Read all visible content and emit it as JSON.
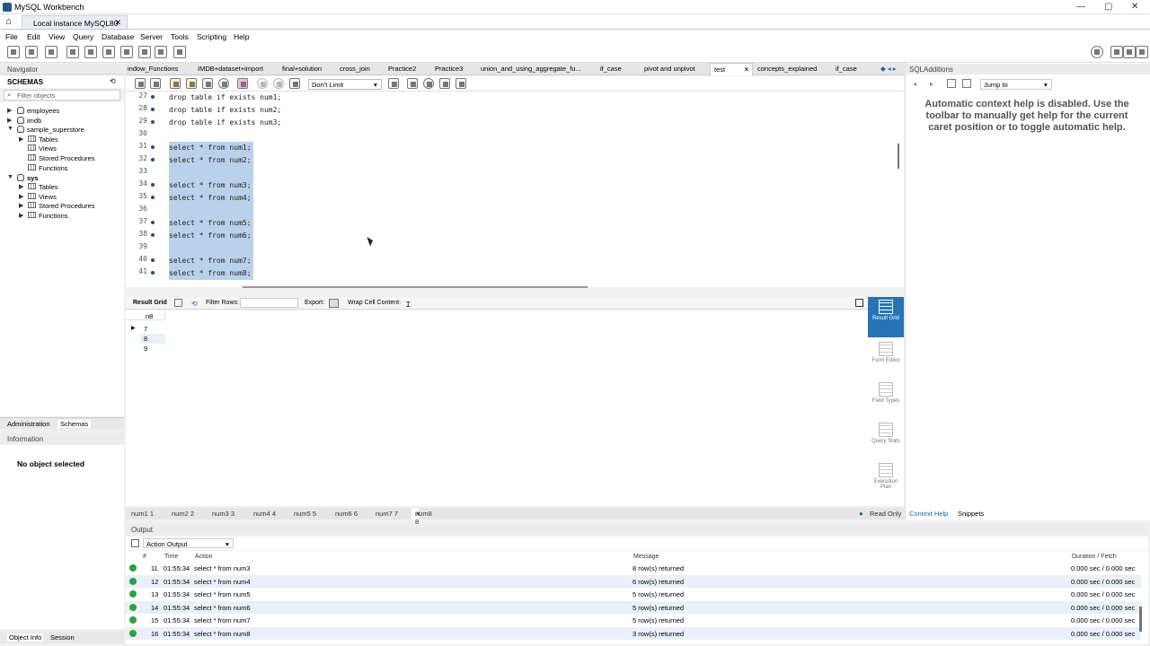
{
  "window": {
    "title": "MySQL Workbench",
    "connection_tab": "Local instance MySQL80"
  },
  "menu": [
    "File",
    "Edit",
    "View",
    "Query",
    "Database",
    "Server",
    "Tools",
    "Scripting",
    "Help"
  ],
  "navigator": {
    "header": "Navigator",
    "schemas_label": "SCHEMAS",
    "filter_placeholder": "Filter objects",
    "tree": [
      {
        "label": "employees",
        "level": 0,
        "arrow": "▶"
      },
      {
        "label": "imdb",
        "level": 0,
        "arrow": "▶"
      },
      {
        "label": "sample_superstore",
        "level": 0,
        "arrow": "▼"
      },
      {
        "label": "Tables",
        "level": 1,
        "arrow": "▶"
      },
      {
        "label": "Views",
        "level": 1,
        "arrow": ""
      },
      {
        "label": "Stored Procedures",
        "level": 1,
        "arrow": ""
      },
      {
        "label": "Functions",
        "level": 1,
        "arrow": ""
      },
      {
        "label": "sys",
        "level": 0,
        "arrow": "▼",
        "bold": true
      },
      {
        "label": "Tables",
        "level": 1,
        "arrow": "▶"
      },
      {
        "label": "Views",
        "level": 1,
        "arrow": "▶"
      },
      {
        "label": "Stored Procedures",
        "level": 1,
        "arrow": "▶"
      },
      {
        "label": "Functions",
        "level": 1,
        "arrow": "▶"
      }
    ],
    "tabs": [
      "Administration",
      "Schemas"
    ],
    "information_header": "Information",
    "no_object": "No object selected",
    "bottom_tabs": [
      "Object Info",
      "Session"
    ]
  },
  "query_tabs": [
    "indow_Functions",
    "IMDB+dataset+import",
    "final+solution",
    "cross_join",
    "Practice2",
    "Practice3",
    "union_and_using_aggregate_fu...",
    "if_case",
    "pivot and unpivot",
    "test",
    "concepts_explained",
    "if_case"
  ],
  "active_query_tab": "test",
  "limit": "Don't Limit",
  "editor_lines": [
    {
      "n": "27",
      "code": "drop table if exists num1;",
      "sel": false,
      "dot": true
    },
    {
      "n": "28",
      "code": "drop table if exists num2;",
      "sel": false,
      "dot": true
    },
    {
      "n": "29",
      "code": "drop table if exists num3;",
      "sel": false,
      "dot": true
    },
    {
      "n": "30",
      "code": "",
      "sel": false,
      "dot": false
    },
    {
      "n": "31",
      "code": "select * from num1;",
      "sel": true,
      "dot": true
    },
    {
      "n": "32",
      "code": "select * from num2;",
      "sel": true,
      "dot": true
    },
    {
      "n": "33",
      "code": "",
      "sel": true,
      "dot": false
    },
    {
      "n": "34",
      "code": "select * from num3;",
      "sel": true,
      "dot": true
    },
    {
      "n": "35",
      "code": "select * from num4;",
      "sel": true,
      "dot": true
    },
    {
      "n": "36",
      "code": "",
      "sel": true,
      "dot": false
    },
    {
      "n": "37",
      "code": "select * from num5;",
      "sel": true,
      "dot": true
    },
    {
      "n": "38",
      "code": "select * from num6;",
      "sel": true,
      "dot": true
    },
    {
      "n": "39",
      "code": "",
      "sel": true,
      "dot": false
    },
    {
      "n": "40",
      "code": "select * from num7;",
      "sel": true,
      "dot": true
    },
    {
      "n": "41",
      "code": "select * from num8;",
      "sel": true,
      "dot": true
    }
  ],
  "result_toolbar": {
    "result_grid": "Result Grid",
    "filter_rows": "Filter Rows:",
    "export": "Export:",
    "wrap": "Wrap Cell Content:"
  },
  "result_grid": {
    "column": "n8",
    "rows": [
      "7",
      "8",
      "9"
    ]
  },
  "result_side": [
    "Result Grid",
    "Form Editor",
    "Field Types",
    "Query Stats",
    "Execution Plan"
  ],
  "result_tabs": [
    "num1 1",
    "num2 2",
    "num3 3",
    "num4 4",
    "num5 5",
    "num6 6",
    "num7 7",
    "num8 8"
  ],
  "read_only": "Read Only",
  "output": {
    "header": "Output",
    "action_selector": "Action Output",
    "columns": {
      "num": "#",
      "time": "Time",
      "action": "Action",
      "message": "Message",
      "duration": "Duration / Fetch"
    },
    "rows": [
      {
        "n": "11",
        "time": "01:55:34",
        "action": "select * from num3",
        "message": "8 row(s) returned",
        "duration": "0.000 sec / 0.000 sec"
      },
      {
        "n": "12",
        "time": "01:55:34",
        "action": "select * from num4",
        "message": "6 row(s) returned",
        "duration": "0.000 sec / 0.000 sec"
      },
      {
        "n": "13",
        "time": "01:55:34",
        "action": "select * from num5",
        "message": "5 row(s) returned",
        "duration": "0.000 sec / 0.000 sec"
      },
      {
        "n": "14",
        "time": "01:55:34",
        "action": "select * from num6",
        "message": "5 row(s) returned",
        "duration": "0.000 sec / 0.000 sec"
      },
      {
        "n": "15",
        "time": "01:55:34",
        "action": "select * from num7",
        "message": "5 row(s) returned",
        "duration": "0.000 sec / 0.000 sec"
      },
      {
        "n": "16",
        "time": "01:55:34",
        "action": "select * from num8",
        "message": "3 row(s) returned",
        "duration": "0.000 sec / 0.000 sec"
      }
    ]
  },
  "sql_additions": {
    "header": "SQLAdditions",
    "jump_to": "Jump to",
    "help_text": "Automatic context help is disabled. Use the toolbar to manually get help for the current caret position or to toggle automatic help.",
    "tabs": [
      "Context Help",
      "Snippets"
    ]
  },
  "icons": {
    "home": "home-icon",
    "close": "close-icon",
    "ok": "check-circle-icon"
  }
}
